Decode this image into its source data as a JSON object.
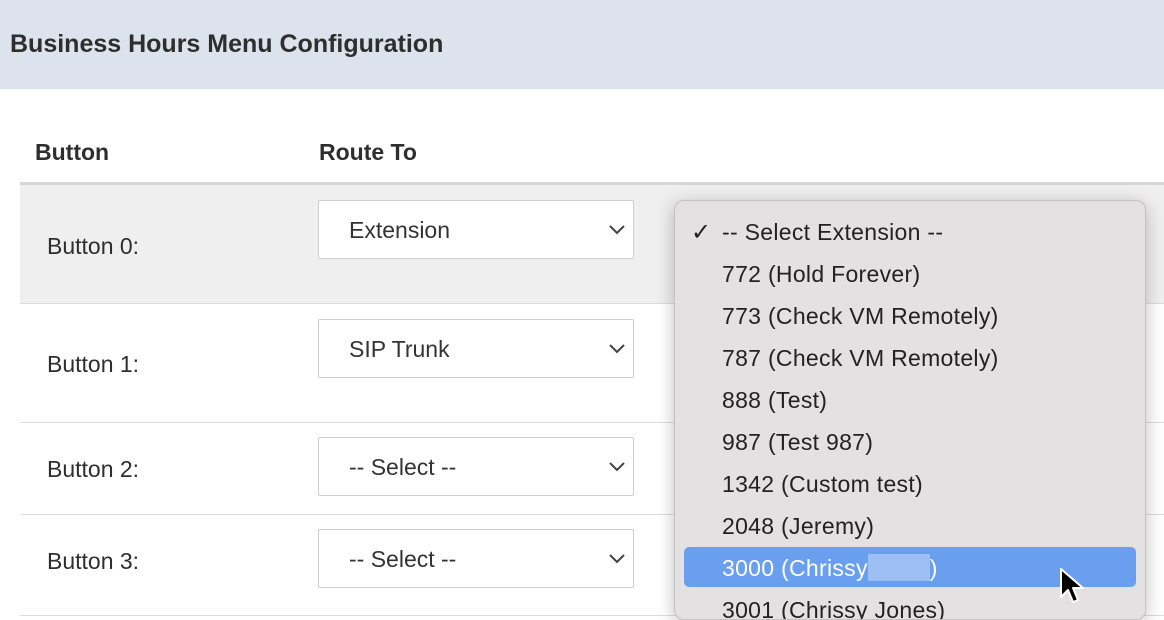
{
  "header": {
    "title": "Business Hours Menu Configuration"
  },
  "table": {
    "columns": [
      "Button",
      "Route To"
    ],
    "rows": [
      {
        "label": "Button 0:",
        "route": "Extension"
      },
      {
        "label": "Button 1:",
        "route": "SIP Trunk"
      },
      {
        "label": "Button 2:",
        "route": "-- Select --"
      },
      {
        "label": "Button 3:",
        "route": "-- Select --"
      }
    ]
  },
  "dropdown": {
    "options": [
      {
        "label": "-- Select Extension --",
        "checked": true
      },
      {
        "label": "772 (Hold Forever)"
      },
      {
        "label": "773 (Check VM Remotely)"
      },
      {
        "label": "787 (Check VM Remotely)"
      },
      {
        "label": "888 (Test)"
      },
      {
        "label": "987 (Test 987)"
      },
      {
        "label": "1342 (Custom test)"
      },
      {
        "label": "2048 (Jeremy)"
      },
      {
        "label_prefix": "3000 (Chrissy",
        "label_suffix": ")",
        "highlighted": true
      },
      {
        "label": "3001 (Chrissy Jones)"
      }
    ],
    "check_glyph": "✓"
  },
  "colors": {
    "header_bg": "#dce3ec",
    "highlight": "#6a9ff0",
    "row_shaded": "#efefef"
  }
}
